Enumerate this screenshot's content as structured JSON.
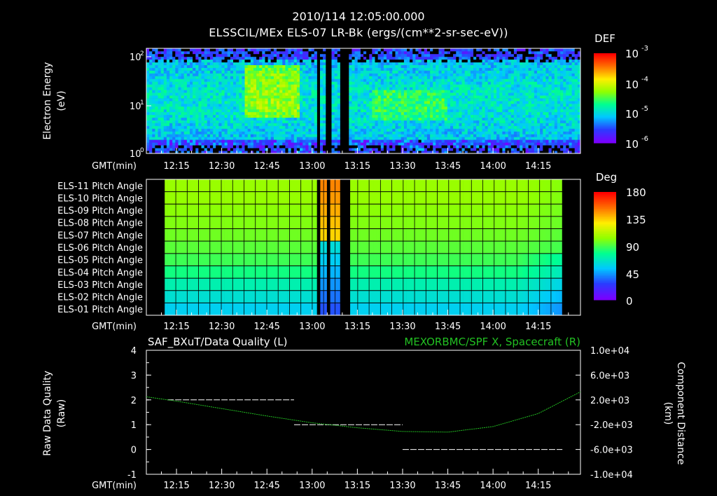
{
  "header": {
    "title_line1": "2010/114 12:05:00.000",
    "title_line2": "ELSSCIL/MEx ELS-07 LR-Bk  (ergs/(cm**2-sr-sec-eV))"
  },
  "time_axis": {
    "label": "GMT(min)",
    "ticks": [
      "12:15",
      "12:30",
      "12:45",
      "13:00",
      "13:15",
      "13:30",
      "13:45",
      "14:00",
      "14:15"
    ]
  },
  "colors": {
    "background": "#000000",
    "foreground": "#ffffff",
    "right_series": "#22c022",
    "colormap": [
      "#7a00ff",
      "#2a3cff",
      "#00c8ff",
      "#00ff90",
      "#90ff00",
      "#ffee00",
      "#ff7000",
      "#ff0000"
    ]
  },
  "chart_data": [
    {
      "type": "heatmap",
      "title": "ELSSCIL/MEx ELS-07 LR-Bk  (ergs/(cm**2-sr-sec-eV))",
      "ylabel": "Electron Energy (eV)",
      "y_scale": "log",
      "yticks": [
        "10^0",
        "10^1",
        "10^2"
      ],
      "colorbar": {
        "label": "DEF",
        "ticks": [
          "10^-3",
          "10^-4",
          "10^-5",
          "10^-6"
        ],
        "scale": "log"
      },
      "gaps": [
        "13:01-13:02",
        "13:05-13:06",
        "13:09-13:12"
      ],
      "features": "broad green/yellow enhancement ~10-100 eV near 12:40-12:55; cyan/blue background elsewhere"
    },
    {
      "type": "heatmap",
      "rows": [
        "ELS-11 Pitch Angle",
        "ELS-10 Pitch Angle",
        "ELS-09 Pitch Angle",
        "ELS-08 Pitch Angle",
        "ELS-07 Pitch Angle",
        "ELS-06 Pitch Angle",
        "ELS-05 Pitch Angle",
        "ELS-04 Pitch Angle",
        "ELS-03 Pitch Angle",
        "ELS-02 Pitch Angle",
        "ELS-01 Pitch Angle"
      ],
      "row_values_deg": [
        105,
        104,
        102,
        100,
        97,
        93,
        88,
        80,
        70,
        62,
        55
      ],
      "colorbar": {
        "label": "Deg",
        "ticks": [
          "180",
          "135",
          "90",
          "45",
          "0"
        ],
        "range": [
          0,
          180
        ]
      },
      "gaps": [
        "13:01-13:02",
        "13:05-13:06",
        "13:09-13:12"
      ]
    },
    {
      "type": "line",
      "title": "SAF_BXuT/Data Quality (L)",
      "ylabel": "Raw Data Quality (Raw)",
      "ylim": [
        -1,
        4
      ],
      "yticks": [
        "-1",
        "0",
        "1",
        "2",
        "3",
        "4"
      ],
      "segments": [
        {
          "x": [
            "12:12",
            "12:54"
          ],
          "y": 2
        },
        {
          "x": [
            "12:54",
            "13:30"
          ],
          "y": 1
        },
        {
          "x": [
            "13:30",
            "14:23"
          ],
          "y": 0
        }
      ]
    },
    {
      "type": "line",
      "title": "MEXORBMC/SPF X, Spacecraft (R)",
      "ylabel": "Component Distance (km)",
      "ylim": [
        -10000,
        10000
      ],
      "yticks": [
        "1.0e+04",
        "6.0e+03",
        "2.0e+03",
        "-2.0e+03",
        "-6.0e+03",
        "-1.0e+04"
      ],
      "x": [
        "12:05",
        "12:15",
        "12:30",
        "12:45",
        "13:00",
        "13:15",
        "13:30",
        "13:45",
        "14:00",
        "14:15",
        "14:29"
      ],
      "values": [
        2500,
        1800,
        600,
        -600,
        -1700,
        -2500,
        -3100,
        -3200,
        -2300,
        -200,
        3300
      ]
    }
  ],
  "labels": {
    "panel1_ylabel1": "Electron Energy",
    "panel1_ylabel2": "(eV)",
    "panel1_cb_title": "DEF",
    "panel1_cb_ticks": [
      "10",
      "10",
      "10",
      "10"
    ],
    "panel1_cb_exps": [
      "-3",
      "-4",
      "-5",
      "-6"
    ],
    "panel1_yticks": [
      "10",
      "10",
      "10"
    ],
    "panel1_yexps": [
      "2",
      "1",
      "0"
    ],
    "panel2_cb_title": "Deg",
    "panel2_cb_ticks": [
      "180",
      "135",
      "90",
      "45",
      "0"
    ],
    "panel3_title_left": "SAF_BXuT/Data Quality (L)",
    "panel3_title_right": "MEXORBMC/SPF X, Spacecraft (R)",
    "panel3_ylabel_left1": "Raw Data Quality",
    "panel3_ylabel_left2": "(Raw)",
    "panel3_ylabel_right1": "Component",
    "panel3_ylabel_right2": "Distance",
    "panel3_ylabel_right3": "(km)",
    "panel3_left_ticks": [
      "4",
      "3",
      "2",
      "1",
      "0",
      "-1"
    ],
    "panel3_right_ticks": [
      "1.0e+04",
      "6.0e+03",
      "2.0e+03",
      "-2.0e+03",
      "-6.0e+03",
      "-1.0e+04"
    ]
  }
}
